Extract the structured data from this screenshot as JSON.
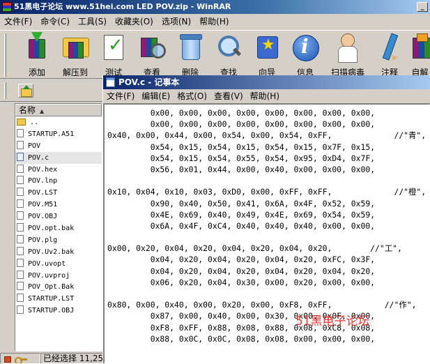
{
  "winrar": {
    "title": "51黑电子论坛 www.51hei.com LED POV.zip - WinRAR",
    "menu": [
      "文件(F)",
      "命令(C)",
      "工具(S)",
      "收藏夹(O)",
      "选项(N)",
      "帮助(H)"
    ],
    "toolbar": [
      {
        "label": "添加",
        "icon": "add-archive-icon"
      },
      {
        "label": "解压到",
        "icon": "extract-folder-icon"
      },
      {
        "label": "测试",
        "icon": "test-checklist-icon"
      },
      {
        "label": "查看",
        "icon": "view-magnifier-icon"
      },
      {
        "label": "删除",
        "icon": "trash-bin-icon"
      },
      {
        "label": "查找",
        "icon": "search-magnifier-icon"
      },
      {
        "label": "向导",
        "icon": "wizard-icon"
      },
      {
        "label": "信息",
        "icon": "info-icon"
      },
      {
        "label": "扫描病毒",
        "icon": "virus-scan-icon"
      },
      {
        "label": "注释",
        "icon": "comment-pen-icon"
      },
      {
        "label": "自解",
        "icon": "sfx-icon"
      }
    ],
    "filelist": {
      "column_name": "名称",
      "files": [
        {
          "name": "..",
          "type": "folder"
        },
        {
          "name": "STARTUP.A51",
          "type": "file"
        },
        {
          "name": "POV",
          "type": "file"
        },
        {
          "name": "POV.c",
          "type": "c",
          "selected": true
        },
        {
          "name": "POV.hex",
          "type": "file"
        },
        {
          "name": "POV.lnp",
          "type": "file"
        },
        {
          "name": "POV.LST",
          "type": "file"
        },
        {
          "name": "POV.M51",
          "type": "file"
        },
        {
          "name": "POV.OBJ",
          "type": "file"
        },
        {
          "name": "POV.opt.bak",
          "type": "file"
        },
        {
          "name": "POV.plg",
          "type": "file"
        },
        {
          "name": "POV.Uv2.bak",
          "type": "file"
        },
        {
          "name": "POV.uvopt",
          "type": "file"
        },
        {
          "name": "POV.uvproj",
          "type": "file"
        },
        {
          "name": "POV_Opt.Bak",
          "type": "file"
        },
        {
          "name": "STARTUP.LST",
          "type": "file"
        },
        {
          "name": "STARTUP.OBJ",
          "type": "file"
        }
      ]
    },
    "status": {
      "selection": "已经选择 11,25"
    }
  },
  "notepad": {
    "title": "POV.c - 记事本",
    "menu": [
      "文件(F)",
      "编辑(E)",
      "格式(O)",
      "查看(V)",
      "帮助(H)"
    ],
    "lines": [
      "         0x00, 0x00, 0x00, 0x00, 0x00, 0x00, 0x00, 0x00,",
      "         0x00, 0x00, 0x00, 0x00, 0x00, 0x00, 0x00, 0x00,",
      "0x40, 0x00, 0x44, 0x00, 0x54, 0x00, 0x54, 0xFF,             //\"青\",",
      "         0x54, 0x15, 0x54, 0x15, 0x54, 0x15, 0x7F, 0x15,",
      "         0x54, 0x15, 0x54, 0x55, 0x54, 0x95, 0xD4, 0x7F,",
      "         0x56, 0x01, 0x44, 0x00, 0x40, 0x00, 0x00, 0x00,",
      "",
      "0x10, 0x04, 0x10, 0x03, 0xD0, 0x00, 0xFF, 0xFF,             //\"橙\",",
      "         0x90, 0x40, 0x50, 0x41, 0x6A, 0x4F, 0x52, 0x59,",
      "         0x4E, 0x69, 0x40, 0x49, 0x4E, 0x69, 0x54, 0x59,",
      "         0x6A, 0x4F, 0xC4, 0x40, 0x40, 0x40, 0x00, 0x00,",
      "",
      "0x00, 0x20, 0x04, 0x20, 0x04, 0x20, 0x04, 0x20,        //\"工\",",
      "         0x04, 0x20, 0x04, 0x20, 0x04, 0x20, 0xFC, 0x3F,",
      "         0x04, 0x20, 0x04, 0x20, 0x04, 0x20, 0x04, 0x20,",
      "         0x06, 0x20, 0x04, 0x30, 0x00, 0x20, 0x00, 0x00,",
      "",
      "0x80, 0x00, 0x40, 0x00, 0x20, 0x00, 0xF8, 0xFF,           //\"作\",",
      "         0x87, 0x00, 0x40, 0x00, 0x30, 0x00, 0x0F, 0x00,",
      "         0xF8, 0xFF, 0x88, 0x08, 0x88, 0x08, 0xC8, 0x08,",
      "         0x88, 0x0C, 0x0C, 0x08, 0x08, 0x00, 0x00, 0x00,"
    ],
    "watermark": "51黑电子论坛"
  },
  "colors": {
    "titlebar_dark": "#0a246a",
    "titlebar_light": "#a6caf0",
    "chrome": "#d4d0c8",
    "watermark": "#e8342c"
  }
}
